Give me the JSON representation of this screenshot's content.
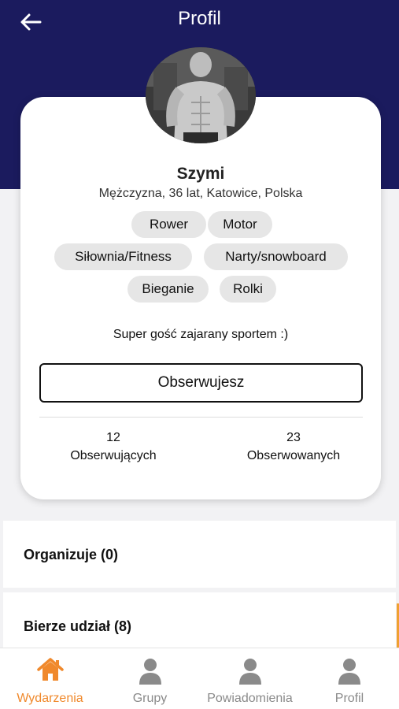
{
  "header": {
    "title": "Profil"
  },
  "profile": {
    "name": "Szymi",
    "meta": "Mężczyzna,  36 lat, Katowice, Polska",
    "interests": [
      "Rower",
      "Motor",
      "Siłownia/Fitness",
      "Narty/snowboard",
      "Bieganie",
      "Rolki"
    ],
    "bio": "Super gość  zajarany sportem :)",
    "follow_label": "Obserwujesz",
    "followers_count": "12",
    "followers_label": "Obserwujących",
    "following_count": "23",
    "following_label": "Obserwowanych"
  },
  "sections": [
    {
      "title": "Organizuje (0)"
    },
    {
      "title": "Bierze udział (8)"
    }
  ],
  "tabs": [
    {
      "label": "Wydarzenia",
      "icon": "home-icon",
      "active": true
    },
    {
      "label": "Grupy",
      "icon": "person-icon",
      "active": false
    },
    {
      "label": "Powiadomienia",
      "icon": "person-icon",
      "active": false
    },
    {
      "label": "Profil",
      "icon": "person-icon",
      "active": false
    }
  ],
  "colors": {
    "header": "#1b1b5e",
    "accent": "#f0892c",
    "inactive": "#8a8a8a"
  }
}
